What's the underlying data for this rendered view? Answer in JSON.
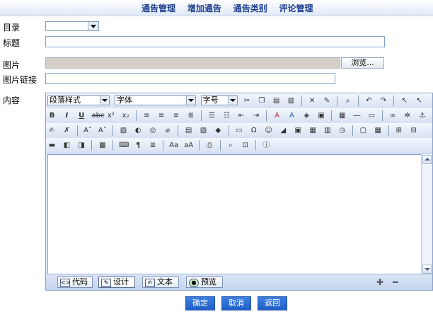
{
  "nav": [
    "通告管理",
    "增加通告",
    "通告类别",
    "评论管理"
  ],
  "form": {
    "category_label": "目录",
    "title_label": "标题",
    "image_label": "图片",
    "browse_label": "浏览...",
    "image_link_label": "图片链接",
    "content_label": "内容"
  },
  "editor": {
    "paragraph_style": "段落样式",
    "font": "字体",
    "font_size": "字号",
    "modes": [
      "代码",
      "设计",
      "文本",
      "预览"
    ],
    "active_mode": "设计"
  },
  "actions": {
    "ok": "确定",
    "cancel": "取消",
    "back": "返回"
  }
}
